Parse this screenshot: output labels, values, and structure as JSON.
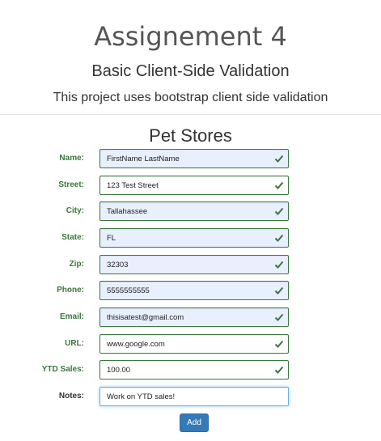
{
  "header": {
    "title": "Assignement 4",
    "subtitle": "Basic Client-Side Validation",
    "lead": "This project uses bootstrap client side validation"
  },
  "form": {
    "heading": "Pet Stores",
    "fields": [
      {
        "label": "Name:",
        "value": "FirstName LastName",
        "valid": true
      },
      {
        "label": "Street:",
        "value": "123 Test Street",
        "valid": true
      },
      {
        "label": "City:",
        "value": "Tallahassee",
        "valid": true
      },
      {
        "label": "State:",
        "value": "FL",
        "valid": true
      },
      {
        "label": "Zip:",
        "value": "32303",
        "valid": true
      },
      {
        "label": "Phone:",
        "value": "5555555555",
        "valid": true
      },
      {
        "label": "Email:",
        "value": "thisisatest@gmail.com",
        "valid": true
      },
      {
        "label": "URL:",
        "value": "www.google.com",
        "valid": true
      },
      {
        "label": "YTD Sales:",
        "value": "100.00",
        "valid": true
      },
      {
        "label": "Notes:",
        "value": "Work on YTD sales!",
        "valid": false
      }
    ],
    "submit_label": "Add"
  },
  "colors": {
    "valid": "#3c763d",
    "autofill_bg": "#e8f0fe",
    "primary": "#337ab7",
    "focus": "#66afe9"
  },
  "icons": {
    "valid_indicator": "check-icon"
  }
}
